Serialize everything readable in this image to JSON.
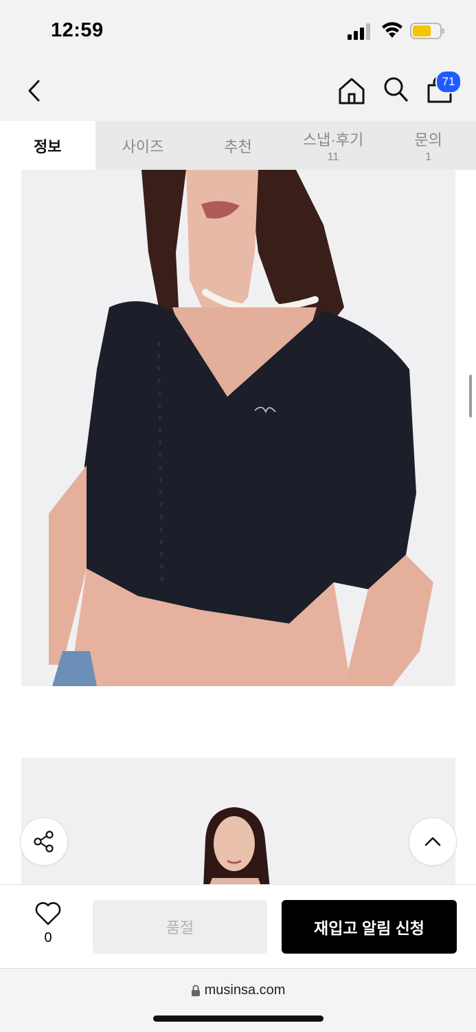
{
  "status_bar": {
    "time": "12:59"
  },
  "nav": {
    "cart_count": "71"
  },
  "tabs": [
    {
      "label": "정보",
      "count": ""
    },
    {
      "label": "사이즈",
      "count": ""
    },
    {
      "label": "추천",
      "count": ""
    },
    {
      "label": "스냅·후기",
      "count": "11"
    },
    {
      "label": "문의",
      "count": "1"
    }
  ],
  "bottom": {
    "like_count": "0",
    "soldout_label": "품절",
    "restock_label": "재입고 알림 신청"
  },
  "browser": {
    "url": "musinsa.com"
  },
  "colors": {
    "accent_badge": "#1f5cff",
    "primary_button": "#000000"
  }
}
